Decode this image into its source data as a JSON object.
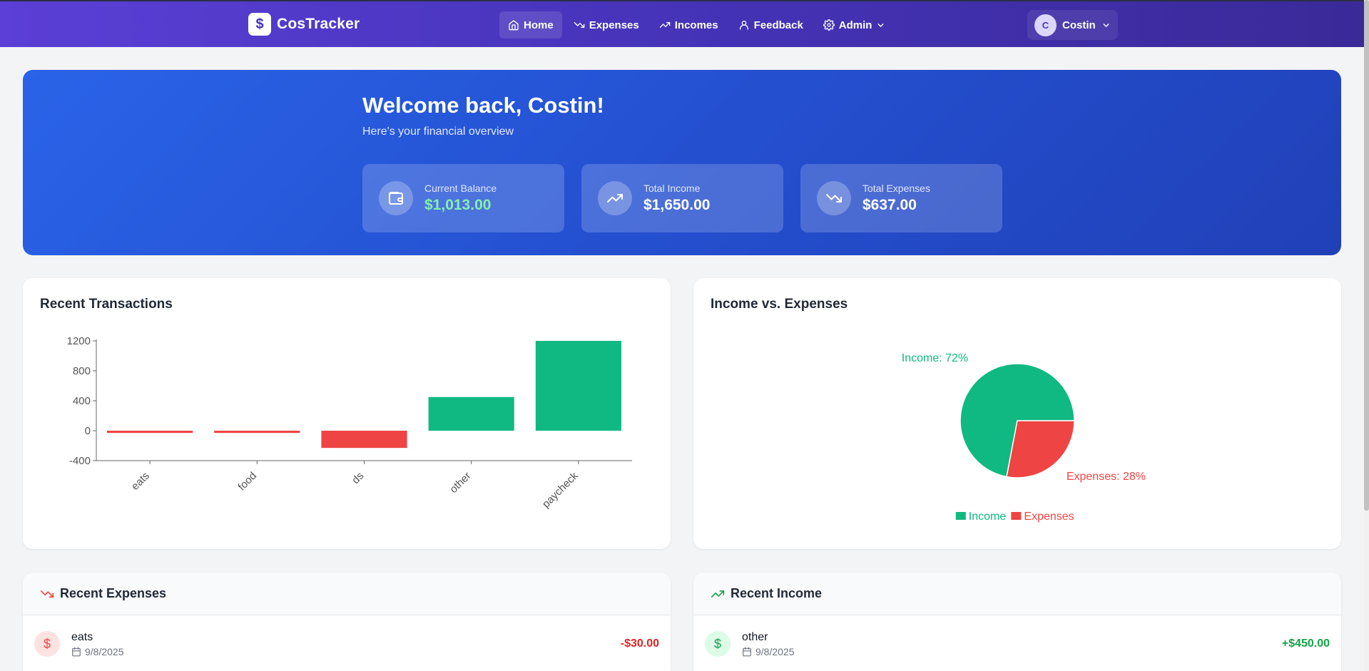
{
  "app": {
    "name": "CosTracker",
    "logo_icon": "dollar-icon"
  },
  "nav": {
    "items": [
      {
        "label": "Home",
        "icon": "home-icon",
        "active": true
      },
      {
        "label": "Expenses",
        "icon": "trending-down-icon"
      },
      {
        "label": "Incomes",
        "icon": "trending-up-icon"
      },
      {
        "label": "Feedback",
        "icon": "user-icon"
      },
      {
        "label": "Admin",
        "icon": "gear-icon"
      }
    ],
    "user": {
      "initial": "C",
      "name": "Costin"
    }
  },
  "hero": {
    "title": "Welcome back, Costin!",
    "subtitle": "Here's your financial overview",
    "stats": [
      {
        "label": "Current Balance",
        "value": "$1,013.00",
        "icon": "wallet-icon",
        "value_color": "#86efac"
      },
      {
        "label": "Total Income",
        "value": "$1,650.00",
        "icon": "trending-up-icon"
      },
      {
        "label": "Total Expenses",
        "value": "$637.00",
        "icon": "trending-down-icon"
      }
    ]
  },
  "recent_transactions": {
    "title": "Recent Transactions"
  },
  "income_vs_expenses": {
    "title": "Income vs. Expenses"
  },
  "chart_data": [
    {
      "type": "bar",
      "title": "Recent Transactions",
      "categories": [
        "eats",
        "food",
        "ds",
        "other",
        "paycheck"
      ],
      "values": [
        -30,
        -30,
        -230,
        450,
        1200
      ],
      "colors": [
        "#ef4444",
        "#ef4444",
        "#ef4444",
        "#10b981",
        "#10b981"
      ],
      "ylim": [
        -400,
        1200
      ],
      "yticks": [
        "-400",
        "0",
        "400",
        "800",
        "1200"
      ],
      "grid": false
    },
    {
      "type": "pie",
      "title": "Income vs. Expenses",
      "series": [
        {
          "name": "Income",
          "value": 72,
          "label": "Income: 72%",
          "color": "#10b981"
        },
        {
          "name": "Expenses",
          "value": 28,
          "label": "Expenses: 28%",
          "color": "#ef4444"
        }
      ],
      "legend": "bottom"
    }
  ],
  "recent_expenses": {
    "title": "Recent Expenses",
    "items": [
      {
        "name": "eats",
        "date": "9/8/2025",
        "amount": "-$30.00"
      }
    ]
  },
  "recent_income": {
    "title": "Recent Income",
    "items": [
      {
        "name": "other",
        "date": "9/8/2025",
        "amount": "+$450.00"
      }
    ]
  },
  "colors": {
    "income": "#10b981",
    "expense": "#ef4444",
    "brand": "#4533b8",
    "hero": "#2450d0"
  }
}
